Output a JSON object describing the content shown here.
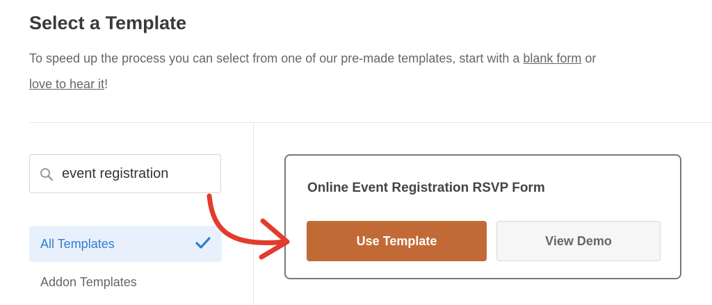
{
  "header": {
    "title": "Select a Template",
    "description_prefix": "To speed up the process you can select from one of our pre-made templates, start with a ",
    "blank_form_link": "blank form",
    "description_middle": " or ",
    "hear_link": "love to hear it",
    "description_suffix": "!"
  },
  "search": {
    "value": "event registration",
    "icon": "search-icon"
  },
  "sidebar": {
    "categories": [
      {
        "label": "All Templates",
        "selected": true,
        "icon": "checkmark-icon"
      },
      {
        "label": "Addon Templates",
        "selected": false
      }
    ]
  },
  "template_card": {
    "title": "Online Event Registration RSVP Form",
    "use_label": "Use Template",
    "demo_label": "View Demo"
  },
  "colors": {
    "accent_button": "#c26a35",
    "selected_category_bg": "#e8f1fb",
    "selected_category_text": "#2f7ccf",
    "annotation_arrow": "#e33b2e"
  }
}
